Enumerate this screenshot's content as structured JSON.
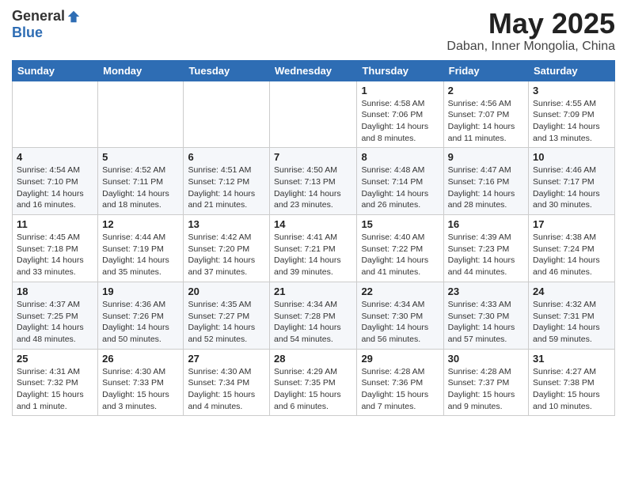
{
  "header": {
    "logo_general": "General",
    "logo_blue": "Blue",
    "title": "May 2025",
    "location": "Daban, Inner Mongolia, China"
  },
  "weekdays": [
    "Sunday",
    "Monday",
    "Tuesday",
    "Wednesday",
    "Thursday",
    "Friday",
    "Saturday"
  ],
  "weeks": [
    [
      {
        "day": "",
        "info": ""
      },
      {
        "day": "",
        "info": ""
      },
      {
        "day": "",
        "info": ""
      },
      {
        "day": "",
        "info": ""
      },
      {
        "day": "1",
        "info": "Sunrise: 4:58 AM\nSunset: 7:06 PM\nDaylight: 14 hours\nand 8 minutes."
      },
      {
        "day": "2",
        "info": "Sunrise: 4:56 AM\nSunset: 7:07 PM\nDaylight: 14 hours\nand 11 minutes."
      },
      {
        "day": "3",
        "info": "Sunrise: 4:55 AM\nSunset: 7:09 PM\nDaylight: 14 hours\nand 13 minutes."
      }
    ],
    [
      {
        "day": "4",
        "info": "Sunrise: 4:54 AM\nSunset: 7:10 PM\nDaylight: 14 hours\nand 16 minutes."
      },
      {
        "day": "5",
        "info": "Sunrise: 4:52 AM\nSunset: 7:11 PM\nDaylight: 14 hours\nand 18 minutes."
      },
      {
        "day": "6",
        "info": "Sunrise: 4:51 AM\nSunset: 7:12 PM\nDaylight: 14 hours\nand 21 minutes."
      },
      {
        "day": "7",
        "info": "Sunrise: 4:50 AM\nSunset: 7:13 PM\nDaylight: 14 hours\nand 23 minutes."
      },
      {
        "day": "8",
        "info": "Sunrise: 4:48 AM\nSunset: 7:14 PM\nDaylight: 14 hours\nand 26 minutes."
      },
      {
        "day": "9",
        "info": "Sunrise: 4:47 AM\nSunset: 7:16 PM\nDaylight: 14 hours\nand 28 minutes."
      },
      {
        "day": "10",
        "info": "Sunrise: 4:46 AM\nSunset: 7:17 PM\nDaylight: 14 hours\nand 30 minutes."
      }
    ],
    [
      {
        "day": "11",
        "info": "Sunrise: 4:45 AM\nSunset: 7:18 PM\nDaylight: 14 hours\nand 33 minutes."
      },
      {
        "day": "12",
        "info": "Sunrise: 4:44 AM\nSunset: 7:19 PM\nDaylight: 14 hours\nand 35 minutes."
      },
      {
        "day": "13",
        "info": "Sunrise: 4:42 AM\nSunset: 7:20 PM\nDaylight: 14 hours\nand 37 minutes."
      },
      {
        "day": "14",
        "info": "Sunrise: 4:41 AM\nSunset: 7:21 PM\nDaylight: 14 hours\nand 39 minutes."
      },
      {
        "day": "15",
        "info": "Sunrise: 4:40 AM\nSunset: 7:22 PM\nDaylight: 14 hours\nand 41 minutes."
      },
      {
        "day": "16",
        "info": "Sunrise: 4:39 AM\nSunset: 7:23 PM\nDaylight: 14 hours\nand 44 minutes."
      },
      {
        "day": "17",
        "info": "Sunrise: 4:38 AM\nSunset: 7:24 PM\nDaylight: 14 hours\nand 46 minutes."
      }
    ],
    [
      {
        "day": "18",
        "info": "Sunrise: 4:37 AM\nSunset: 7:25 PM\nDaylight: 14 hours\nand 48 minutes."
      },
      {
        "day": "19",
        "info": "Sunrise: 4:36 AM\nSunset: 7:26 PM\nDaylight: 14 hours\nand 50 minutes."
      },
      {
        "day": "20",
        "info": "Sunrise: 4:35 AM\nSunset: 7:27 PM\nDaylight: 14 hours\nand 52 minutes."
      },
      {
        "day": "21",
        "info": "Sunrise: 4:34 AM\nSunset: 7:28 PM\nDaylight: 14 hours\nand 54 minutes."
      },
      {
        "day": "22",
        "info": "Sunrise: 4:34 AM\nSunset: 7:30 PM\nDaylight: 14 hours\nand 56 minutes."
      },
      {
        "day": "23",
        "info": "Sunrise: 4:33 AM\nSunset: 7:30 PM\nDaylight: 14 hours\nand 57 minutes."
      },
      {
        "day": "24",
        "info": "Sunrise: 4:32 AM\nSunset: 7:31 PM\nDaylight: 14 hours\nand 59 minutes."
      }
    ],
    [
      {
        "day": "25",
        "info": "Sunrise: 4:31 AM\nSunset: 7:32 PM\nDaylight: 15 hours\nand 1 minute."
      },
      {
        "day": "26",
        "info": "Sunrise: 4:30 AM\nSunset: 7:33 PM\nDaylight: 15 hours\nand 3 minutes."
      },
      {
        "day": "27",
        "info": "Sunrise: 4:30 AM\nSunset: 7:34 PM\nDaylight: 15 hours\nand 4 minutes."
      },
      {
        "day": "28",
        "info": "Sunrise: 4:29 AM\nSunset: 7:35 PM\nDaylight: 15 hours\nand 6 minutes."
      },
      {
        "day": "29",
        "info": "Sunrise: 4:28 AM\nSunset: 7:36 PM\nDaylight: 15 hours\nand 7 minutes."
      },
      {
        "day": "30",
        "info": "Sunrise: 4:28 AM\nSunset: 7:37 PM\nDaylight: 15 hours\nand 9 minutes."
      },
      {
        "day": "31",
        "info": "Sunrise: 4:27 AM\nSunset: 7:38 PM\nDaylight: 15 hours\nand 10 minutes."
      }
    ]
  ]
}
